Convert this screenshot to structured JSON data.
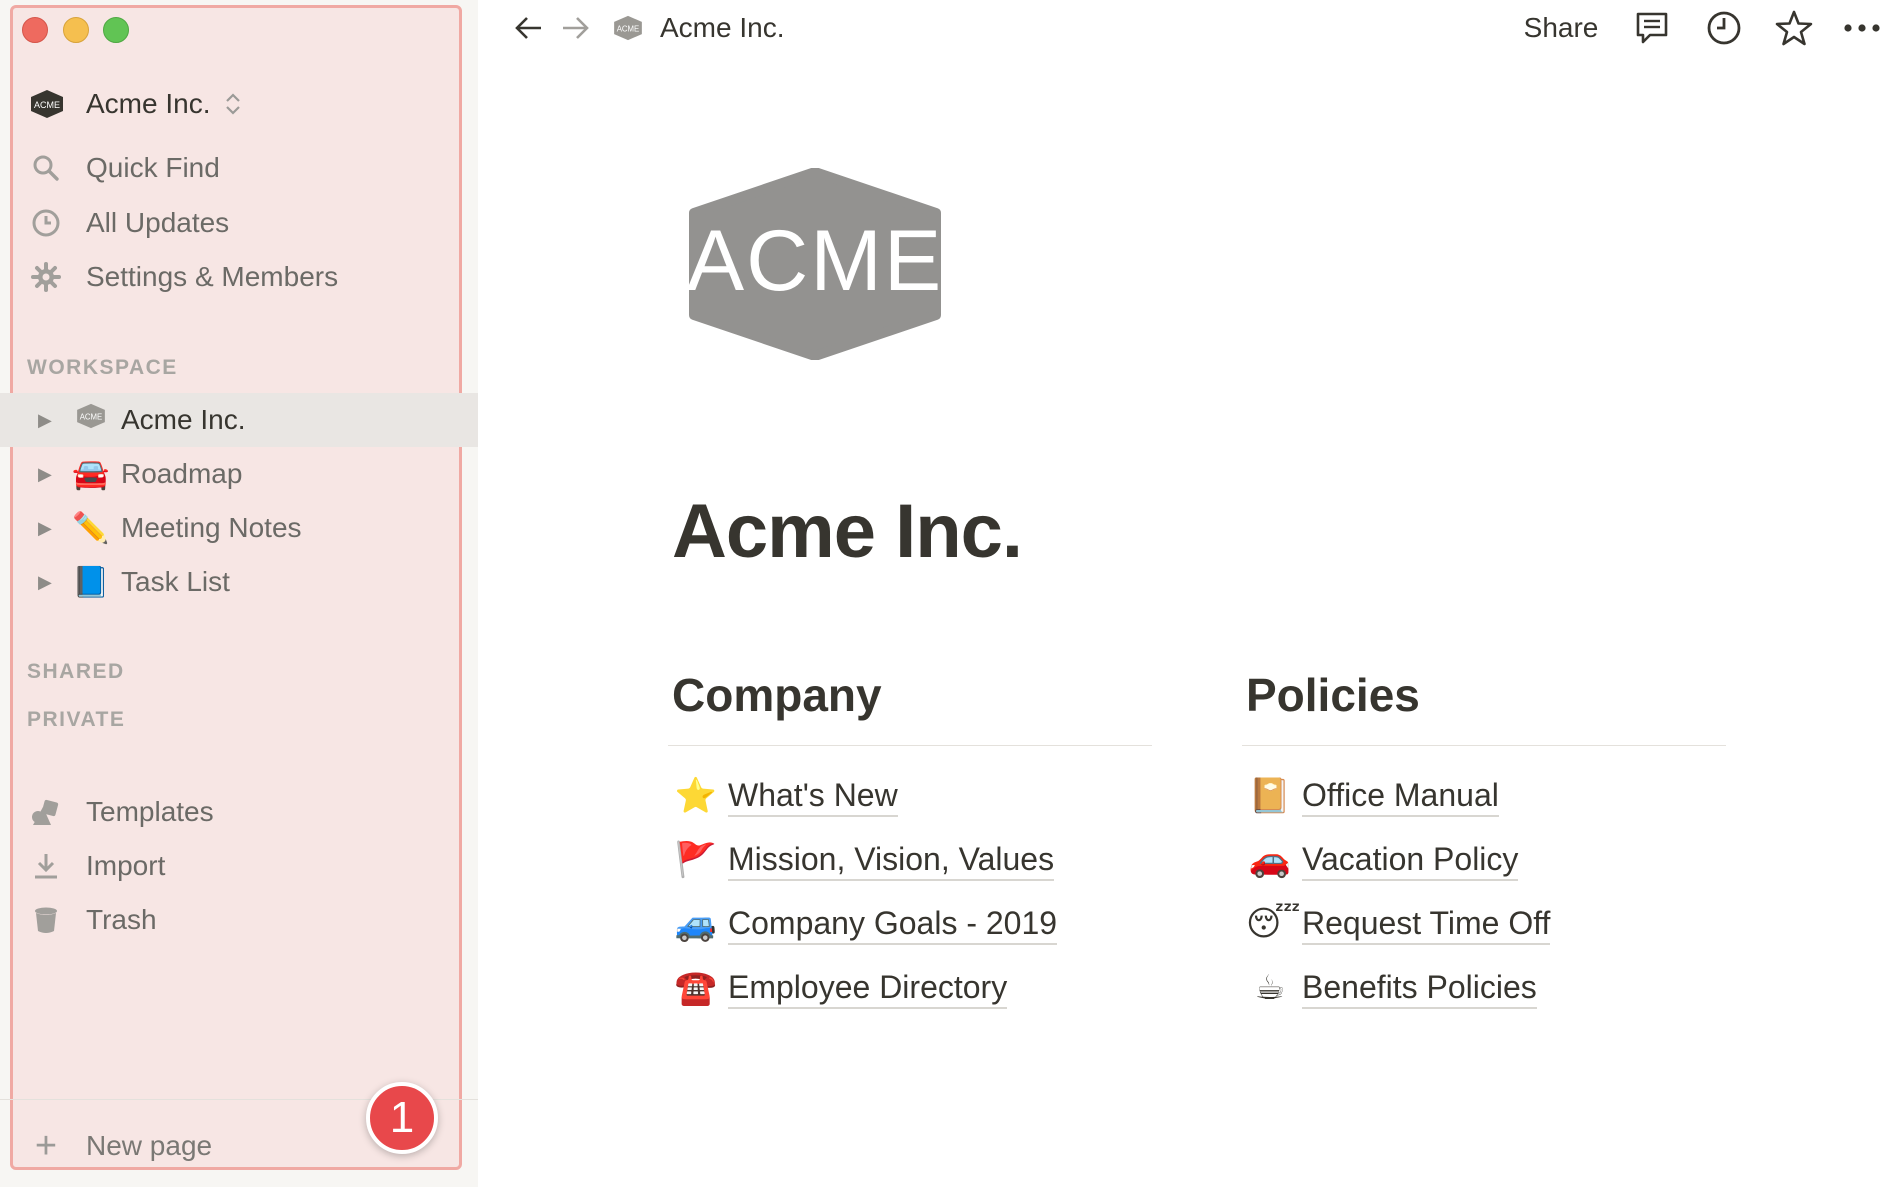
{
  "window": {
    "controls": [
      "close",
      "minimize",
      "zoom"
    ]
  },
  "sidebar": {
    "workspace_name": "Acme Inc.",
    "workspace_logo_text": "ACME",
    "nav": [
      {
        "label": "Quick Find",
        "icon": "search-icon"
      },
      {
        "label": "All Updates",
        "icon": "clock-icon"
      },
      {
        "label": "Settings & Members",
        "icon": "gear-icon"
      }
    ],
    "sections": {
      "workspace": "WORKSPACE",
      "shared": "SHARED",
      "private": "PRIVATE"
    },
    "pages": [
      {
        "label": "Acme Inc.",
        "emoji": "acme-logo",
        "active": true
      },
      {
        "label": "Roadmap",
        "emoji": "🚘",
        "active": false
      },
      {
        "label": "Meeting Notes",
        "emoji": "✏️",
        "active": false
      },
      {
        "label": "Task List",
        "emoji": "📘",
        "active": false
      }
    ],
    "tools": [
      {
        "label": "Templates",
        "icon": "templates-icon"
      },
      {
        "label": "Import",
        "icon": "import-icon"
      },
      {
        "label": "Trash",
        "icon": "trash-icon"
      }
    ],
    "new_page_label": "New page",
    "badge_count": "1"
  },
  "topbar": {
    "breadcrumb": "Acme Inc.",
    "share_label": "Share",
    "icons": [
      "back-arrow-icon",
      "forward-arrow-icon",
      "comment-icon",
      "history-icon",
      "favorite-star-icon",
      "more-icon"
    ]
  },
  "page": {
    "logo_text": "ACME",
    "title": "Acme Inc.",
    "columns": [
      {
        "heading": "Company",
        "links": [
          {
            "emoji": "⭐",
            "label": "What's New"
          },
          {
            "emoji": "🚩",
            "label": "Mission, Vision, Values"
          },
          {
            "emoji": "🚙",
            "label": "Company Goals - 2019"
          },
          {
            "emoji": "☎️",
            "label": "Employee Directory"
          }
        ]
      },
      {
        "heading": "Policies",
        "links": [
          {
            "emoji": "📔",
            "label": "Office Manual"
          },
          {
            "emoji": "🚗",
            "label": "Vacation Policy"
          },
          {
            "emoji": "😴",
            "label": "Request Time Off"
          },
          {
            "emoji": "☕",
            "label": "Benefits Policies"
          }
        ]
      }
    ]
  },
  "colors": {
    "sidebar_bg": "#f7f6f3",
    "highlight_fill": "#f7e6e4",
    "highlight_border": "#f0a9a3",
    "badge": "#e8484b",
    "text": "#37352f",
    "muted": "#6b6a66"
  }
}
